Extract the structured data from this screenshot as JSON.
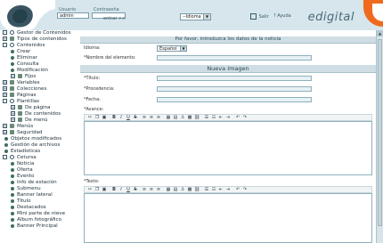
{
  "header": {
    "usuario_label": "Usuario",
    "usuario_value": "admin",
    "contrasena_label": "Contraseña",
    "entrar_label": "entrar >>",
    "idioma_select": "--Idioma",
    "salir_label": "Salir",
    "ayuda_label": "Ayuda",
    "brand": "edigital"
  },
  "sidebar": {
    "items": [
      {
        "label": "Gestor de Contenidos",
        "icon": "root-circle-icon"
      },
      {
        "label": "Tipos de contenidos",
        "icon": "folder-icon"
      },
      {
        "label": "Contenidos",
        "icon": "root-circle-icon"
      },
      {
        "label": "Crear",
        "icon": "dot-icon"
      },
      {
        "label": "Eliminar",
        "icon": "dot-icon"
      },
      {
        "label": "Consulta",
        "icon": "dot-icon"
      },
      {
        "label": "Modificación",
        "icon": "dot-icon"
      },
      {
        "label": "Fijos",
        "icon": "folder-icon"
      },
      {
        "label": "Variables",
        "icon": "folder-icon"
      },
      {
        "label": "Colecciones",
        "icon": "folder-icon"
      },
      {
        "label": "Páginas",
        "icon": "folder-icon"
      },
      {
        "label": "Plantillas",
        "icon": "root-circle-icon"
      },
      {
        "label": "De página",
        "icon": "folder-icon"
      },
      {
        "label": "De contenidos",
        "icon": "folder-icon"
      },
      {
        "label": "De menú",
        "icon": "folder-icon"
      },
      {
        "label": "Menús",
        "icon": "folder-icon"
      },
      {
        "label": "Seguridad",
        "icon": "folder-icon"
      },
      {
        "label": "Objetos modificados",
        "icon": "dot-icon"
      },
      {
        "label": "Gestión de archivos",
        "icon": "dot-icon"
      },
      {
        "label": "Estadísticas",
        "icon": "dot-icon"
      },
      {
        "label": "Cetursa",
        "icon": "root-circle-icon"
      },
      {
        "label": "Noticia",
        "icon": "dot-icon"
      },
      {
        "label": "Oferta",
        "icon": "dot-icon"
      },
      {
        "label": "Evento",
        "icon": "dot-icon"
      },
      {
        "label": "Info de estación",
        "icon": "dot-icon"
      },
      {
        "label": "Submenu",
        "icon": "dot-icon"
      },
      {
        "label": "Banner lateral",
        "icon": "dot-icon"
      },
      {
        "label": "Titulo",
        "icon": "dot-icon"
      },
      {
        "label": "Destacados",
        "icon": "dot-icon"
      },
      {
        "label": "Mini parte de nieve",
        "icon": "dot-icon"
      },
      {
        "label": "Album fotográfico",
        "icon": "dot-icon"
      },
      {
        "label": "Banner Principal",
        "icon": "dot-icon"
      }
    ]
  },
  "main": {
    "instructions": "Por favor, introduzca los datos de la noticia",
    "idioma_label": "Idioma:",
    "idioma_value": "Español",
    "nombre_label": "*Nombre del elemento:",
    "nueva_imagen": "Nueva Imagen",
    "titulo_label": "*Título:",
    "procedencia_label": "*Procedencia:",
    "fecha_label": "*Fecha:",
    "avance_label": "*Avance:",
    "texto_label": "*Texto:",
    "toolbar_icons": [
      "cut-icon",
      "copy-icon",
      "paste-icon",
      "bold-icon",
      "italic-icon",
      "underline-icon",
      "strike-icon",
      "align-left-icon",
      "align-center-icon",
      "align-right-icon",
      "table-icon",
      "table-row-icon",
      "anchor-icon",
      "image-icon",
      "link-icon",
      "ordered-list-icon",
      "unordered-list-icon",
      "outdent-icon",
      "indent-icon",
      "undo-icon",
      "redo-icon"
    ]
  },
  "colors": {
    "header_bg": "#d6e6ec",
    "accent_orange": "#ef6a1f",
    "bar_bg": "#cfdee4",
    "field_bg": "#e7f1f4"
  }
}
